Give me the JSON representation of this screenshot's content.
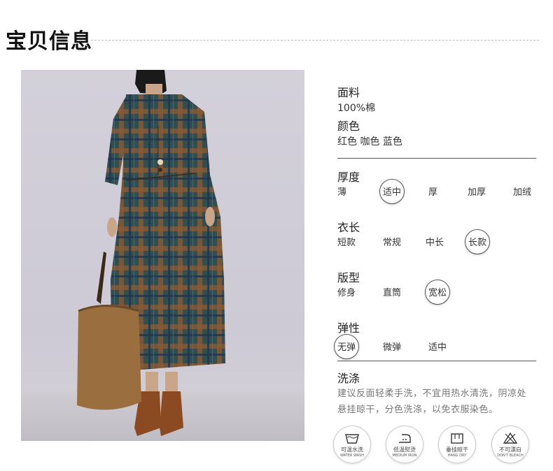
{
  "header": {
    "title": "宝贝信息"
  },
  "info": {
    "fabric_label": "面料",
    "fabric_value": "100%棉",
    "color_label": "颜色",
    "color_value": "红色 咖色  蓝色"
  },
  "thickness": {
    "label": "厚度",
    "options": [
      "薄",
      "适中",
      "厚",
      "加厚",
      "加绒"
    ],
    "selected": "适中"
  },
  "length": {
    "label": "衣长",
    "options": [
      "短款",
      "常规",
      "中长",
      "长款"
    ],
    "selected": "长款"
  },
  "fit": {
    "label": "版型",
    "options": [
      "修身",
      "直筒",
      "宽松"
    ],
    "selected": "宽松"
  },
  "elasticity": {
    "label": "弹性",
    "options": [
      "无弹",
      "微弹",
      "适中"
    ],
    "selected": "无弹"
  },
  "washing": {
    "label": "洗涤",
    "line1": "建议反面轻柔手洗，不宜用热水清洗，阴凉处",
    "line2": "悬挂晾干，分色洗涤，以免衣服染色。",
    "icons": [
      {
        "cn": "可温水洗",
        "en": "WATER WASH",
        "icon": "washtub-icon"
      },
      {
        "cn": "低温熨烫",
        "en": "MEDIUM IRON",
        "icon": "iron-icon"
      },
      {
        "cn": "垂挂晾干",
        "en": "HANG DRY",
        "icon": "hanger-icon"
      },
      {
        "cn": "不可漂白",
        "en": "DON'T BLEACH",
        "icon": "no-bleach-icon"
      }
    ]
  }
}
